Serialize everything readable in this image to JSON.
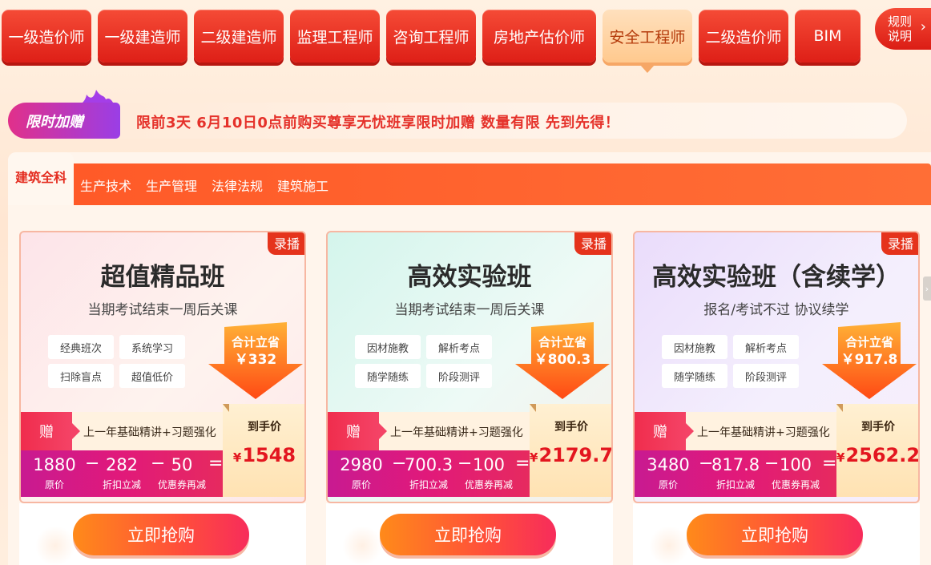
{
  "exam_tabs": [
    {
      "label": "一级造价师"
    },
    {
      "label": "一级建造师"
    },
    {
      "label": "二级建造师"
    },
    {
      "label": "监理工程师"
    },
    {
      "label": "咨询工程师"
    },
    {
      "label": "房地产估价师"
    },
    {
      "label": "安全工程师",
      "active": true
    },
    {
      "label": "二级造价师"
    },
    {
      "label": "BIM"
    }
  ],
  "rules": {
    "line1": "规则",
    "line2": "说明"
  },
  "promo": {
    "badge": "限时加赠",
    "text": "限前3天  6月10日0点前购买尊享无忧班享限时加赠  数量有限  先到先得！"
  },
  "subjects": {
    "active": "建筑全科",
    "items": [
      "生产技术",
      "生产管理",
      "法律法规",
      "建筑施工"
    ]
  },
  "cards": [
    {
      "tag": "录播",
      "title": "超值精品班",
      "subtitle": "当期考试结束一周后关课",
      "features": [
        "经典班次",
        "系统学习",
        "扫除盲点",
        "超值低价"
      ],
      "save_label": "合计立省",
      "save_amount": "￥332",
      "gift_mark": "赠",
      "gift_text": "上一年基础精讲+习题强化",
      "original": "1880",
      "original_cap": "原价",
      "discount": "282",
      "discount_cap": "折扣立减",
      "coupon": "50",
      "coupon_cap": "优惠券再减",
      "op_minus": "−",
      "op_eq": "=",
      "final_cap": "到手价",
      "final_yen": "¥",
      "final_price": "1548",
      "buy_label": "立即抢购"
    },
    {
      "tag": "录播",
      "title": "高效实验班",
      "subtitle": "当期考试结束一周后关课",
      "features": [
        "因材施教",
        "解析考点",
        "随学随练",
        "阶段测评"
      ],
      "save_label": "合计立省",
      "save_amount": "￥800.3",
      "gift_mark": "赠",
      "gift_text": "上一年基础精讲+习题强化",
      "original": "2980",
      "original_cap": "原价",
      "discount": "700.3",
      "discount_cap": "折扣立减",
      "coupon": "100",
      "coupon_cap": "优惠券再减",
      "op_minus": "−",
      "op_eq": "=",
      "final_cap": "到手价",
      "final_yen": "¥",
      "final_price": "2179.7",
      "buy_label": "立即抢购"
    },
    {
      "tag": "录播",
      "title": "高效实验班（含续学）",
      "subtitle": "报名/考试不过 协议续学",
      "features": [
        "因材施教",
        "解析考点",
        "随学随练",
        "阶段测评"
      ],
      "save_label": "合计立省",
      "save_amount": "￥917.8",
      "gift_mark": "赠",
      "gift_text": "上一年基础精讲+习题强化",
      "original": "3480",
      "original_cap": "原价",
      "discount": "817.8",
      "discount_cap": "折扣立减",
      "coupon": "100",
      "coupon_cap": "优惠券再减",
      "op_minus": "−",
      "op_eq": "=",
      "final_cap": "到手价",
      "final_yen": "¥",
      "final_price": "2562.2",
      "buy_label": "立即抢购"
    }
  ],
  "icons": {
    "rules_chevron": "chevron-right-icon",
    "side_scroll": "chevron-right-icon"
  },
  "colors": {
    "primary_red": "#e42b1e",
    "tab_red": "#de1f17",
    "active_tab": "#ffc98e",
    "price_red": "#e3161f"
  }
}
